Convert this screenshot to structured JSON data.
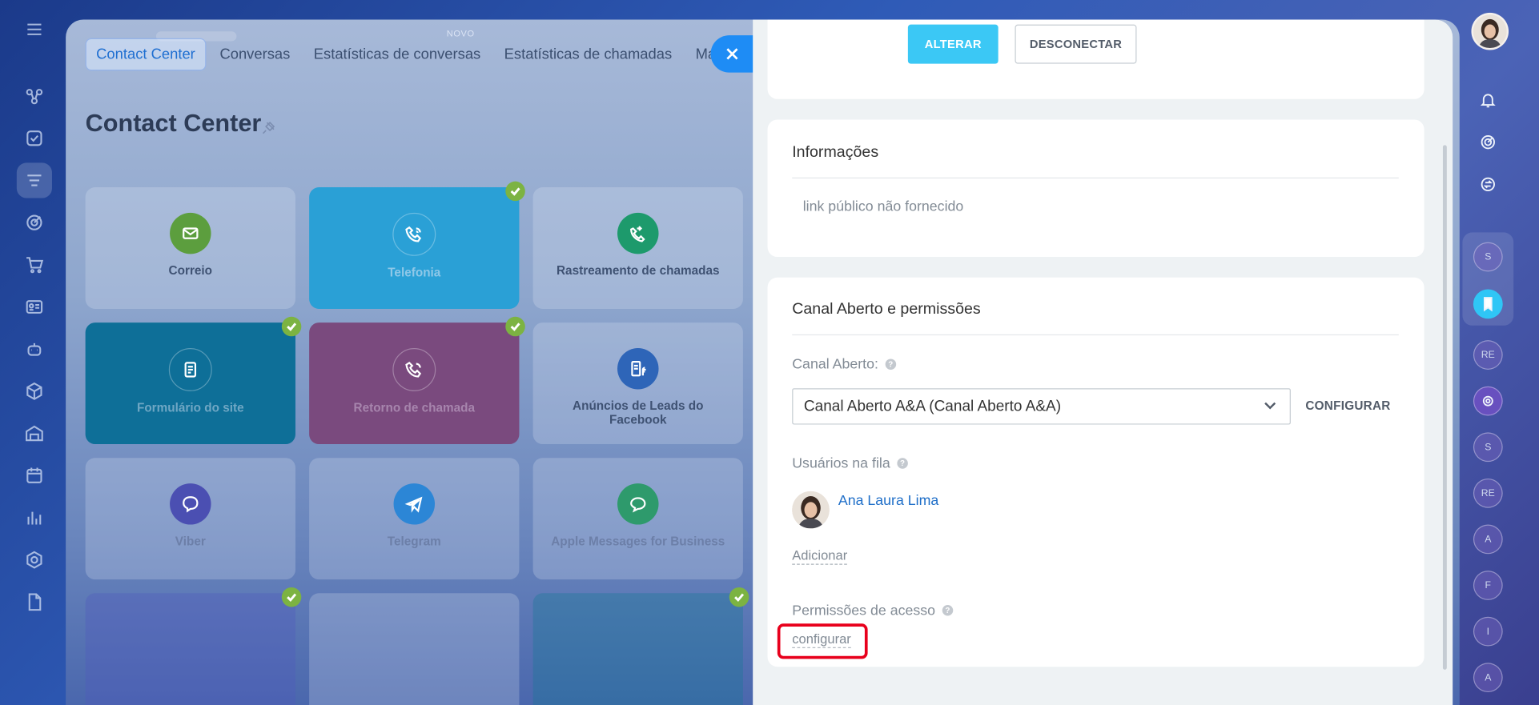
{
  "topbar": {
    "badge": "NOVO"
  },
  "tabs": [
    {
      "label": "Contact Center",
      "active": true
    },
    {
      "label": "Conversas"
    },
    {
      "label": "Estatísticas de conversas"
    },
    {
      "label": "Estatísticas de chamadas"
    },
    {
      "label": "Mais"
    }
  ],
  "page": {
    "title": "Contact Center"
  },
  "tiles": [
    {
      "label": "Correio",
      "icon": "mail-icon",
      "color": "#5c9e3e",
      "checked": false
    },
    {
      "label": "Telefonia",
      "icon": "phone-icon",
      "color": "#2aa0d6",
      "checked": true
    },
    {
      "label": "Rastreamento de chamadas",
      "icon": "call-tracking-icon",
      "color": "#1d9a6c",
      "checked": false
    },
    {
      "label": "Formulário do site",
      "icon": "form-icon",
      "color": "#0e6f98",
      "checked": true
    },
    {
      "label": "Retorno de chamada",
      "icon": "callback-icon",
      "color": "#7a4a7e",
      "checked": true
    },
    {
      "label": "Anúncios de Leads do Facebook",
      "icon": "facebook-leads-icon",
      "color": "#2e65b8",
      "checked": false
    },
    {
      "label": "Viber",
      "icon": "viber-icon",
      "color": "#4b4fb2",
      "checked": false
    },
    {
      "label": "Telegram",
      "icon": "telegram-icon",
      "color": "#2c86d6",
      "checked": false
    },
    {
      "label": "Apple Messages for Business",
      "icon": "chat-bubble-icon",
      "color": "#2e9a6c",
      "checked": false
    }
  ],
  "panel": {
    "buttons": {
      "change": "ALTERAR",
      "disconnect": "DESCONECTAR"
    },
    "info": {
      "title": "Informações",
      "text": "link público não fornecido"
    },
    "permissions": {
      "title": "Canal Aberto e permissões",
      "channel_label": "Canal Aberto:",
      "channel_value": "Canal Aberto A&A (Canal Aberto A&A)",
      "configure_button": "CONFIGURAR",
      "queue_label": "Usuários na fila",
      "queue_user": "Ana Laura Lima",
      "add_link": "Adicionar",
      "access_label": "Permissões de acesso",
      "access_link": "configurar",
      "help_mark": "?"
    }
  },
  "rightbar": {
    "avatars": [
      "S",
      "RE",
      "S",
      "RE",
      "A",
      "F",
      "I",
      "A"
    ]
  },
  "colors": {
    "accent": "#3bc8f5",
    "link": "#1e6ec8",
    "close": "#1e8cf5",
    "highlight": "#e8001c"
  }
}
